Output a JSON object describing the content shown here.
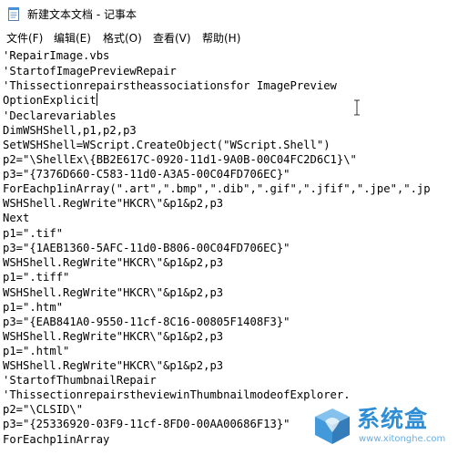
{
  "window": {
    "title": "新建文本文档 - 记事本",
    "icon": "notepad-icon"
  },
  "menu": [
    {
      "label": "文件(F)"
    },
    {
      "label": "编辑(E)"
    },
    {
      "label": "格式(O)"
    },
    {
      "label": "查看(V)"
    },
    {
      "label": "帮助(H)"
    }
  ],
  "editor": {
    "lines": [
      "'RepairImage.vbs",
      "'StartofImagePreviewRepair",
      "'Thissectionrepairstheassociationsfor ImagePreview",
      "OptionExplicit",
      "'Declarevariables",
      "DimWSHShell,p1,p2,p3",
      "SetWSHShell=WScript.CreateObject(\"WScript.Shell\")",
      "p2=\"\\ShellEx\\{BB2E617C-0920-11d1-9A0B-00C04FC2D6C1}\\\"",
      "p3=\"{7376D660-C583-11d0-A3A5-00C04FD706EC}\"",
      "ForEachp1inArray(\".art\",\".bmp\",\".dib\",\".gif\",\".jfif\",\".jpe\",\".jp",
      "WSHShell.RegWrite\"HKCR\\\"&p1&p2,p3",
      "Next",
      "p1=\".tif\"",
      "p3=\"{1AEB1360-5AFC-11d0-B806-00C04FD706EC}\"",
      "WSHShell.RegWrite\"HKCR\\\"&p1&p2,p3",
      "p1=\".tiff\"",
      "WSHShell.RegWrite\"HKCR\\\"&p1&p2,p3",
      "p1=\".htm\"",
      "p3=\"{EAB841A0-9550-11cf-8C16-00805F1408F3}\"",
      "WSHShell.RegWrite\"HKCR\\\"&p1&p2,p3",
      "p1=\".html\"",
      "WSHShell.RegWrite\"HKCR\\\"&p1&p2,p3",
      "'StartofThumbnailRepair",
      "'ThissectionrepairstheviewinThumbnailmodeofExplorer.",
      "p2=\"\\CLSID\\\"",
      "p3=\"{25336920-03F9-11cf-8FD0-00AA00686F13}\"",
      "ForEachp1inArray"
    ]
  },
  "watermark": {
    "title": "系统盒",
    "url": "www.xitonghe.com",
    "color": "#2f8fd6"
  }
}
